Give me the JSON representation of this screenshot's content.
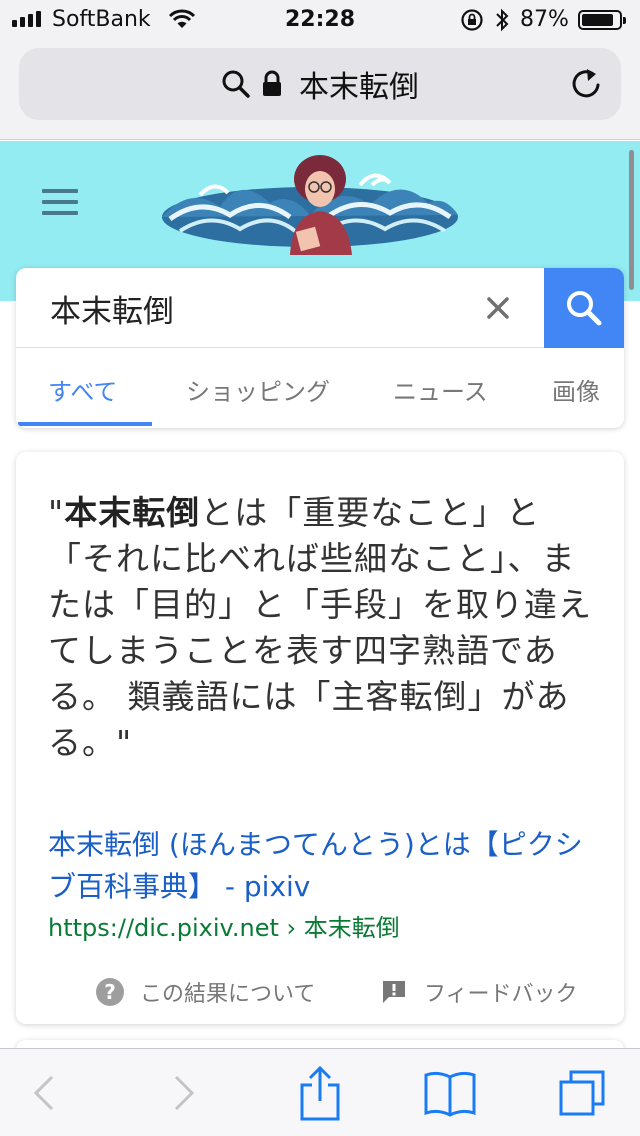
{
  "status_bar": {
    "carrier": "SoftBank",
    "time": "22:28",
    "battery_percent": "87%",
    "battery_level": 0.87
  },
  "address_bar": {
    "text": "本末転倒"
  },
  "search": {
    "query": "本末転倒",
    "tabs": [
      {
        "label": "すべて",
        "active": true
      },
      {
        "label": "ショッピング",
        "active": false
      },
      {
        "label": "ニュース",
        "active": false
      },
      {
        "label": "画像",
        "active": false
      }
    ]
  },
  "result": {
    "snippet_open": "\"",
    "snippet_bold": "本末転倒",
    "snippet_rest": "とは「重要なこと」と「それに比べれば些細なこと」、または「目的」と「手段」を取り違えてしまうことを表す四字熟語である。 類義語には「主客転倒」がある。\"",
    "link_title": "本末転倒 (ほんまつてんとう)とは【ピクシブ百科事典】 - pixiv",
    "url": "https://dic.pixiv.net › 本末転倒",
    "about_label": "この結果について",
    "feedback_label": "フィードバック"
  },
  "colors": {
    "header_bg": "#93ecf2",
    "google_blue": "#4285f4",
    "link_blue": "#1a5fc8",
    "url_green": "#0a7b35",
    "ios_blue": "#1a7cf5"
  },
  "icons": {
    "menu": "hamburger-menu-icon",
    "clear": "close-icon",
    "search": "search-icon",
    "about": "question-circle-icon",
    "feedback": "feedback-icon",
    "back": "chevron-left-icon",
    "forward": "chevron-right-icon",
    "share": "share-icon",
    "bookmarks": "bookmarks-icon",
    "tabs": "tabs-icon"
  }
}
